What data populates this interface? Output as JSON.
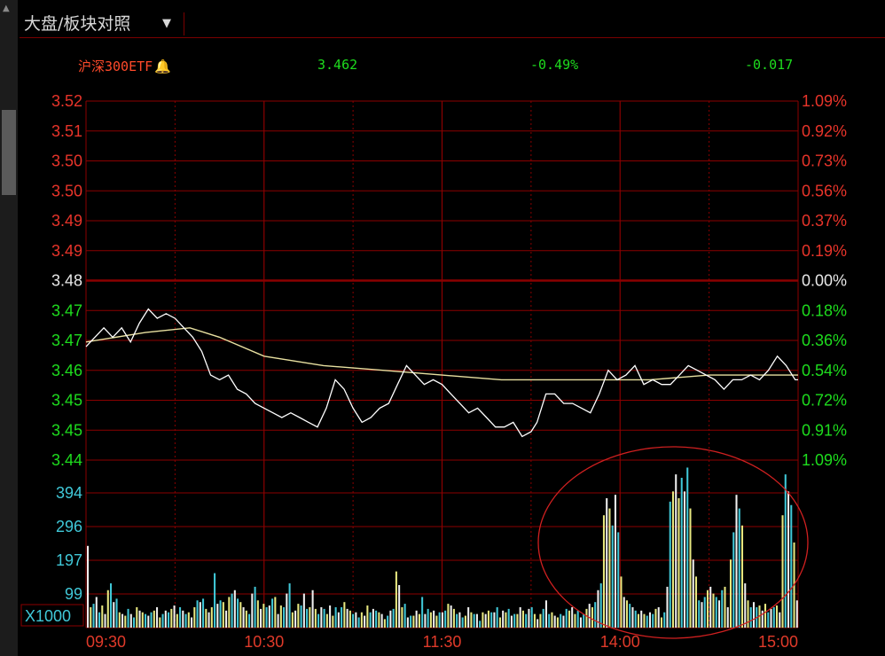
{
  "toolbar": {
    "dropdown_label": "大盘/板块对照",
    "dropdown_caret": "▼"
  },
  "info": {
    "name": "沪深300ETF",
    "price": "3.462",
    "change_pct": "-0.49%",
    "change": "-0.017",
    "bell_icon": "bell-icon"
  },
  "colors": {
    "up": "#e8342a",
    "down": "#1edc1e",
    "neutral": "#e8e8e8",
    "grid": "#8b0000",
    "price_line": "#ffffff",
    "avg_line": "#e8e0a0",
    "vol_cyan": "#40c8d8",
    "vol_yellow": "#e8e880",
    "vol_white": "#f0f0f0",
    "annotation": "#d02020"
  },
  "chart_data": {
    "type": "line",
    "title": "沪深300ETF",
    "prev_close": 3.479,
    "y_left_ticks": [
      "3.52",
      "3.51",
      "3.50",
      "3.50",
      "3.49",
      "3.49",
      "3.48",
      "3.47",
      "3.47",
      "3.46",
      "3.45",
      "3.45",
      "3.44"
    ],
    "y_right_ticks": [
      "1.09%",
      "0.92%",
      "0.73%",
      "0.56%",
      "0.37%",
      "0.19%",
      "0.00%",
      "0.18%",
      "0.36%",
      "0.54%",
      "0.72%",
      "0.91%",
      "1.09%"
    ],
    "ylim": [
      3.441,
      3.517
    ],
    "x_ticks": [
      "09:30",
      "10:30",
      "11:30",
      "14:00",
      "15:00"
    ],
    "series": [
      {
        "values": [
          [
            0,
            3.465
          ],
          [
            3,
            3.467
          ],
          [
            6,
            3.469
          ],
          [
            9,
            3.467
          ],
          [
            12,
            3.469
          ],
          [
            15,
            3.466
          ],
          [
            18,
            3.47
          ],
          [
            21,
            3.473
          ],
          [
            24,
            3.471
          ],
          [
            27,
            3.472
          ],
          [
            30,
            3.471
          ],
          [
            33,
            3.469
          ],
          [
            36,
            3.467
          ],
          [
            39,
            3.464
          ],
          [
            42,
            3.459
          ],
          [
            45,
            3.458
          ],
          [
            48,
            3.459
          ],
          [
            51,
            3.456
          ],
          [
            54,
            3.455
          ],
          [
            57,
            3.453
          ],
          [
            60,
            3.452
          ],
          [
            63,
            3.451
          ],
          [
            66,
            3.45
          ],
          [
            69,
            3.451
          ],
          [
            72,
            3.45
          ],
          [
            75,
            3.449
          ],
          [
            78,
            3.448
          ],
          [
            81,
            3.452
          ],
          [
            84,
            3.458
          ],
          [
            87,
            3.456
          ],
          [
            90,
            3.452
          ],
          [
            93,
            3.449
          ],
          [
            96,
            3.45
          ],
          [
            99,
            3.452
          ],
          [
            102,
            3.453
          ],
          [
            105,
            3.457
          ],
          [
            108,
            3.461
          ],
          [
            111,
            3.459
          ],
          [
            114,
            3.457
          ],
          [
            117,
            3.458
          ],
          [
            120,
            3.457
          ],
          [
            123,
            3.455
          ],
          [
            126,
            3.453
          ],
          [
            129,
            3.451
          ],
          [
            132,
            3.452
          ],
          [
            135,
            3.45
          ],
          [
            138,
            3.448
          ],
          [
            141,
            3.448
          ],
          [
            144,
            3.449
          ],
          [
            147,
            3.446
          ],
          [
            150,
            3.447
          ],
          [
            152,
            3.449
          ],
          [
            155,
            3.455
          ],
          [
            158,
            3.455
          ],
          [
            161,
            3.453
          ],
          [
            164,
            3.453
          ],
          [
            167,
            3.452
          ],
          [
            170,
            3.451
          ],
          [
            173,
            3.455
          ],
          [
            176,
            3.46
          ],
          [
            179,
            3.458
          ],
          [
            182,
            3.459
          ],
          [
            185,
            3.461
          ],
          [
            188,
            3.457
          ],
          [
            191,
            3.458
          ],
          [
            194,
            3.457
          ],
          [
            197,
            3.457
          ],
          [
            200,
            3.459
          ],
          [
            203,
            3.461
          ],
          [
            206,
            3.46
          ],
          [
            209,
            3.459
          ],
          [
            212,
            3.458
          ],
          [
            215,
            3.456
          ],
          [
            218,
            3.458
          ],
          [
            221,
            3.458
          ],
          [
            224,
            3.459
          ],
          [
            227,
            3.458
          ],
          [
            230,
            3.46
          ],
          [
            233,
            3.463
          ],
          [
            236,
            3.461
          ],
          [
            239,
            3.458
          ],
          [
            240,
            3.458
          ]
        ]
      },
      {
        "values": [
          [
            0,
            3.466
          ],
          [
            20,
            3.468
          ],
          [
            35,
            3.469
          ],
          [
            45,
            3.467
          ],
          [
            60,
            3.463
          ],
          [
            80,
            3.461
          ],
          [
            100,
            3.46
          ],
          [
            120,
            3.459
          ],
          [
            140,
            3.458
          ],
          [
            160,
            3.458
          ],
          [
            175,
            3.458
          ],
          [
            190,
            3.458
          ],
          [
            210,
            3.459
          ],
          [
            225,
            3.459
          ],
          [
            240,
            3.459
          ]
        ]
      }
    ],
    "volume": {
      "y_ticks": [
        "394",
        "296",
        "197",
        "99"
      ],
      "unit": "X1000",
      "ylim": [
        0,
        492
      ],
      "values": [
        240,
        60,
        70,
        90,
        45,
        65,
        40,
        110,
        130,
        75,
        85,
        45,
        40,
        35,
        55,
        40,
        30,
        60,
        50,
        45,
        40,
        35,
        45,
        50,
        60,
        30,
        40,
        50,
        45,
        55,
        65,
        40,
        60,
        50,
        40,
        45,
        30,
        60,
        80,
        75,
        85,
        55,
        45,
        60,
        160,
        70,
        80,
        75,
        50,
        90,
        100,
        110,
        85,
        75,
        60,
        50,
        40,
        100,
        120,
        80,
        55,
        70,
        60,
        65,
        85,
        90,
        40,
        65,
        60,
        100,
        130,
        45,
        50,
        70,
        65,
        100,
        55,
        60,
        110,
        55,
        40,
        60,
        55,
        40,
        65,
        35,
        60,
        45,
        60,
        75,
        55,
        50,
        40,
        45,
        30,
        45,
        35,
        65,
        45,
        55,
        50,
        45,
        40,
        25,
        35,
        50,
        55,
        165,
        125,
        60,
        70,
        30,
        35,
        35,
        50,
        40,
        90,
        40,
        55,
        45,
        50,
        35,
        45,
        45,
        50,
        70,
        65,
        55,
        40,
        45,
        30,
        35,
        60,
        45,
        40,
        40,
        20,
        45,
        40,
        50,
        45,
        45,
        60,
        30,
        50,
        45,
        55,
        35,
        40,
        40,
        60,
        50,
        40,
        55,
        60,
        40,
        25,
        40,
        55,
        80,
        40,
        45,
        35,
        30,
        40,
        35,
        55,
        50,
        60,
        40,
        50,
        30,
        40,
        55,
        70,
        60,
        75,
        110,
        130,
        330,
        380,
        350,
        300,
        390,
        280,
        150,
        90,
        80,
        70,
        60,
        50,
        40,
        50,
        40,
        35,
        45,
        40,
        55,
        60,
        30,
        45,
        120,
        370,
        400,
        450,
        380,
        440,
        400,
        470,
        350,
        200,
        150,
        80,
        75,
        90,
        110,
        120,
        100,
        90,
        80,
        110,
        120,
        60,
        200,
        280,
        390,
        350,
        300,
        130,
        80,
        60,
        75,
        60,
        65,
        50,
        70,
        45,
        55,
        60,
        65,
        45,
        330,
        450,
        400,
        360,
        250,
        80
      ]
    }
  },
  "annotation": {
    "shape": "ellipse",
    "label": "volume-spike-highlight"
  }
}
